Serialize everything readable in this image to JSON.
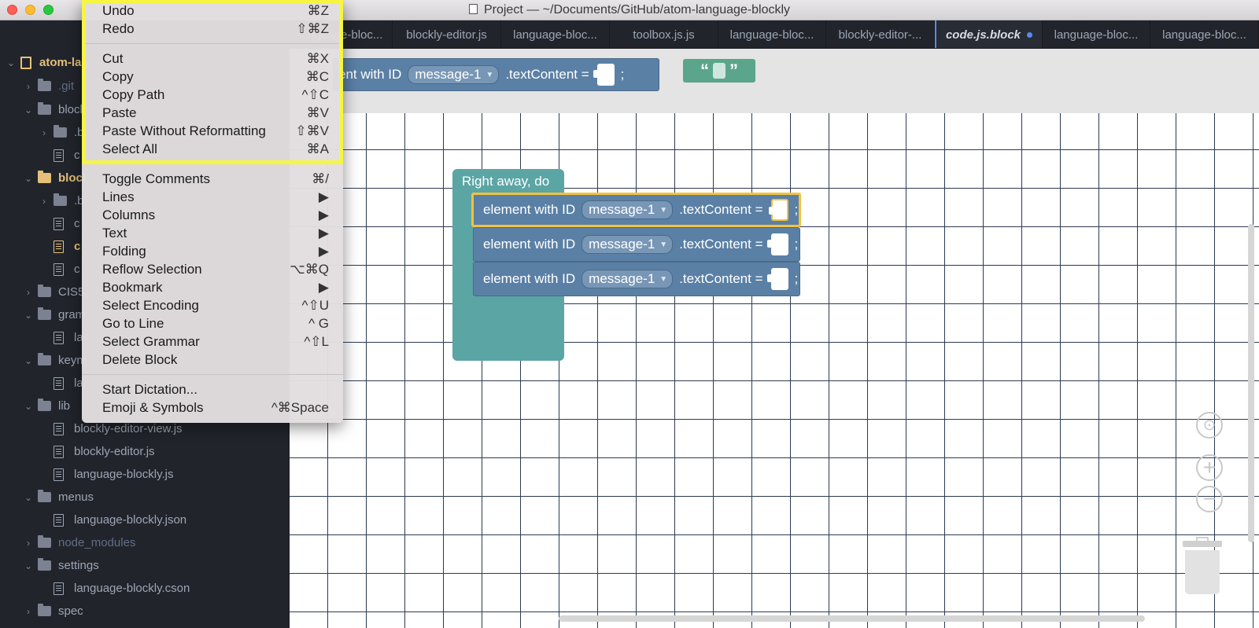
{
  "window": {
    "title": "Project — ~/Documents/GitHub/atom-language-blockly"
  },
  "tabs": [
    {
      "label": "language-bloc..."
    },
    {
      "label": "blockly-editor.js"
    },
    {
      "label": "language-bloc..."
    },
    {
      "label": "toolbox.js.js"
    },
    {
      "label": "language-bloc..."
    },
    {
      "label": "blockly-editor-..."
    },
    {
      "label": "code.js.block"
    },
    {
      "label": "language-bloc..."
    },
    {
      "label": "language-bloc..."
    }
  ],
  "sidebar": {
    "root": "atom-la",
    "items": [
      {
        "label": ".git"
      },
      {
        "label": "blocl"
      },
      {
        "label": ".b"
      },
      {
        "label": "c"
      },
      {
        "label": "blocl"
      },
      {
        "label": ".b"
      },
      {
        "label": "c"
      },
      {
        "label": "c"
      },
      {
        "label": "c"
      },
      {
        "label": "CIS5"
      },
      {
        "label": "gram"
      },
      {
        "label": "la"
      },
      {
        "label": "keym"
      },
      {
        "label": "la"
      },
      {
        "label": "lib"
      },
      {
        "label": "blockly-editor-view.js"
      },
      {
        "label": "blockly-editor.js"
      },
      {
        "label": "language-blockly.js"
      },
      {
        "label": "menus"
      },
      {
        "label": "language-blockly.json"
      },
      {
        "label": "node_modules"
      },
      {
        "label": "settings"
      },
      {
        "label": "language-blockly.cson"
      },
      {
        "label": "spec"
      }
    ]
  },
  "menu": {
    "items": [
      {
        "label": "Undo",
        "shortcut": "⌘Z"
      },
      {
        "label": "Redo",
        "shortcut": "⇧⌘Z"
      },
      {
        "label": "Cut",
        "shortcut": "⌘X"
      },
      {
        "label": "Copy",
        "shortcut": "⌘C"
      },
      {
        "label": "Copy Path",
        "shortcut": "^⇧C"
      },
      {
        "label": "Paste",
        "shortcut": "⌘V"
      },
      {
        "label": "Paste Without Reformatting",
        "shortcut": "⇧⌘V"
      },
      {
        "label": "Select All",
        "shortcut": "⌘A"
      },
      {
        "label": "Toggle Comments",
        "shortcut": "⌘/"
      },
      {
        "label": "Lines",
        "shortcut": "▶"
      },
      {
        "label": "Columns",
        "shortcut": "▶"
      },
      {
        "label": "Text",
        "shortcut": "▶"
      },
      {
        "label": "Folding",
        "shortcut": "▶"
      },
      {
        "label": "Reflow Selection",
        "shortcut": "⌥⌘Q"
      },
      {
        "label": "Bookmark",
        "shortcut": "▶"
      },
      {
        "label": "Select Encoding",
        "shortcut": "^⇧U"
      },
      {
        "label": "Go to Line",
        "shortcut": "^ G"
      },
      {
        "label": "Select Grammar",
        "shortcut": "^⇧L"
      },
      {
        "label": "Delete Block",
        "shortcut": ""
      },
      {
        "label": "Start Dictation...",
        "shortcut": ""
      },
      {
        "label": "Emoji & Symbols",
        "shortcut": "^⌘Space"
      }
    ]
  },
  "flyout": {
    "block_prefix": "ent with ID",
    "dropdown": "message-1",
    "property": ".textContent =",
    "terminator": ";",
    "text_open": "“",
    "text_close": "”"
  },
  "workspace": {
    "container_label": "Right away, do",
    "statements": [
      {
        "label": "element with ID",
        "dropdown": "message-1",
        "property": ".textContent =",
        "terminator": ";",
        "selected": true
      },
      {
        "label": "element with ID",
        "dropdown": "message-1",
        "property": ".textContent =",
        "terminator": ";",
        "selected": false
      },
      {
        "label": "element with ID",
        "dropdown": "message-1",
        "property": ".textContent =",
        "terminator": ";",
        "selected": false
      }
    ]
  },
  "controls": {
    "zoom_in": "+",
    "zoom_out": "−"
  },
  "colors": {
    "menu_highlight": "#f6f542",
    "block_blue": "#5b80a5",
    "block_teal": "#5ba5a5",
    "block_green": "#5ba58c",
    "selected_outline": "#f2c23f",
    "modified_dot": "#568af2"
  }
}
